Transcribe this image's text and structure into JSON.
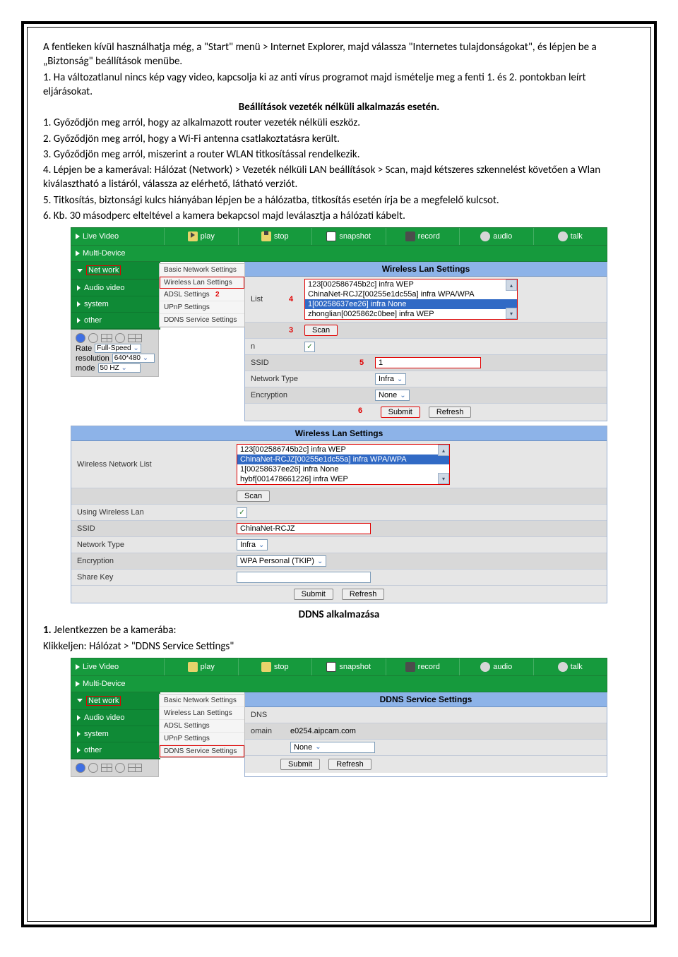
{
  "text": {
    "p1": "A fentieken kívül használhatja még, a \"Start\" menü > Internet Explorer, majd válassza \"Internetes tulajdonságokat\", és lépjen be a „Biztonság\" beállítások menübe.",
    "p2": "1. Ha változatlanul nincs kép vagy video, kapcsolja ki az anti vírus programot majd ismételje meg a fenti 1. és 2. pontokban leírt eljárásokat.",
    "heading1": "Beállítások vezeték nélküli alkalmazás esetén.",
    "l1": "1. Győződjön meg arról, hogy az alkalmazott router vezeték nélküli eszköz.",
    "l2": "2. Győződjön meg arról, hogy a Wi-Fi antenna csatlakoztatásra került.",
    "l3": "3. Győződjön meg arról, miszerint a router WLAN titkosítással rendelkezik.",
    "l4": "4. Lépjen be a kamerával: Hálózat (Network) > Vezeték nélküli LAN beállítások > Scan, majd kétszeres szkennelést követően a Wlan kiválasztható a listáról, válassza az elérhető, látható verziót.",
    "l5": "5. Titkosítás, biztonsági kulcs hiányában lépjen be a hálózatba, titkosítás esetén írja be a megfelelő kulcsot.",
    "l6": "6. Kb. 30 másodperc elteltével a kamera bekapcsol majd leválasztja a hálózati kábelt.",
    "heading2": "DDNS alkalmazása",
    "p3_a": "1.",
    "p3_b": " Jelentkezzen be a kamerába:",
    "p4": "Klikkeljen: Hálózat > \"DDNS Service Settings\""
  },
  "toolbar": {
    "live": "Live Video",
    "multi": "Multi-Device",
    "play": "play",
    "stop": "stop",
    "snapshot": "snapshot",
    "record": "record",
    "audio": "audio",
    "talk": "talk"
  },
  "sidebar": {
    "network": "Net work",
    "audiovideo": "Audio video",
    "system": "system",
    "other": "other"
  },
  "submenu": {
    "basic": "Basic Network Settings",
    "wlan": "Wireless Lan Settings",
    "adsl": "ADSL Settings",
    "upnp": "UPnP Settings",
    "ddns": "DDNS Service Settings"
  },
  "controls": {
    "rate_lbl": "Rate",
    "rate": "Full-Speed",
    "res_lbl": "resolution",
    "res": "640*480",
    "mode_lbl": "mode",
    "mode": "50 HZ"
  },
  "panel1": {
    "title": "Wireless Lan Settings",
    "list_suffix": "List",
    "list": [
      "123[002586745b2c] infra WEP",
      "ChinaNet-RCJZ[00255e1dc55a] infra WPA/WPA",
      "1[00258637ee26] infra None",
      "zhonglian[0025862c0bee] infra WEP"
    ],
    "scan": "Scan",
    "using_suffix": "n",
    "ssid_lbl": "SSID",
    "ssid_val": "1",
    "ntype_lbl": "Network Type",
    "ntype_val": "Infra",
    "enc_lbl": "Encryption",
    "enc_val": "None",
    "submit": "Submit",
    "refresh": "Refresh",
    "m2": "2",
    "m3": "3",
    "m4": "4",
    "m5": "5",
    "m6": "6"
  },
  "panel2": {
    "title": "Wireless Lan Settings",
    "wnl": "Wireless Network List",
    "list": [
      "123[002586745b2c] infra WEP",
      "ChinaNet-RCJZ[00255e1dc55a] infra WPA/WPA",
      "1[00258637ee26] infra None",
      "hybf[001478661226] infra WEP"
    ],
    "scan": "Scan",
    "using": "Using Wireless Lan",
    "ssid_lbl": "SSID",
    "ssid_val": "ChinaNet-RCJZ",
    "ntype_lbl": "Network Type",
    "ntype_val": "Infra",
    "enc_lbl": "Encryption",
    "enc_val": "WPA Personal (TKIP)",
    "share_lbl": "Share Key",
    "submit": "Submit",
    "refresh": "Refresh"
  },
  "panel3": {
    "title": "DDNS Service Settings",
    "dns_lbl": "DNS",
    "domain_lbl": "omain",
    "domain_val": "e0254.aipcam.com",
    "none": "None",
    "submit": "Submit",
    "refresh": "Refresh"
  }
}
